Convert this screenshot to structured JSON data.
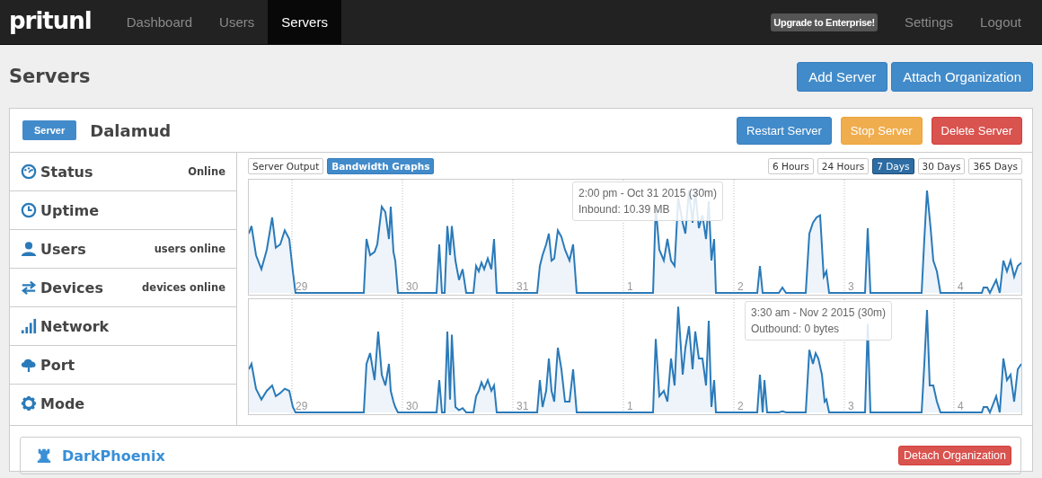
{
  "brand": "pritunl",
  "nav": [
    {
      "label": "Dashboard",
      "selected": false
    },
    {
      "label": "Users",
      "selected": false
    },
    {
      "label": "Servers",
      "selected": true
    }
  ],
  "upgrade": "Upgrade to Enterprise!",
  "nav_right": [
    "Settings",
    "Logout"
  ],
  "page_title": "Servers",
  "page_actions": [
    "Add Server",
    "Attach Organization"
  ],
  "server": {
    "badge": "Server",
    "name": "Dalamud",
    "actions": [
      {
        "label": "Restart Server",
        "kind": "primary"
      },
      {
        "label": "Stop Server",
        "kind": "warning"
      },
      {
        "label": "Delete Server",
        "kind": "danger"
      }
    ],
    "info": [
      {
        "label": "Status",
        "value": "Online"
      },
      {
        "label": "Uptime"
      },
      {
        "label": "Users",
        "value": "users online"
      },
      {
        "label": "Devices",
        "value": "devices online"
      },
      {
        "label": "Network"
      },
      {
        "label": "Port"
      },
      {
        "label": "Mode"
      }
    ],
    "view_tabs": [
      {
        "label": "Server Output",
        "selected": false
      },
      {
        "label": "Bandwidth Graphs",
        "selected": true
      }
    ],
    "ranges": [
      {
        "label": "6 Hours",
        "selected": false
      },
      {
        "label": "24 Hours",
        "selected": false
      },
      {
        "label": "7 Days",
        "selected": true
      },
      {
        "label": "30 Days",
        "selected": false
      },
      {
        "label": "365 Days",
        "selected": false
      }
    ],
    "graphs": [
      {
        "kind": "inbound",
        "day_labels": [
          "29",
          "30",
          "31",
          "1",
          "2",
          "3",
          "4"
        ],
        "tooltip": [
          "2:00 pm - Oct 31 2015 (30m)",
          "Inbound: 10.39 MB"
        ]
      },
      {
        "kind": "outbound",
        "day_labels": [
          "29",
          "30",
          "31",
          "1",
          "2",
          "3",
          "4"
        ],
        "tooltip": [
          "3:30 am - Nov 2 2015 (30m)",
          "Outbound: 0 bytes"
        ]
      }
    ]
  },
  "organizations": [
    {
      "name": "DarkPhoenix",
      "action": "Detach Organization"
    }
  ]
}
